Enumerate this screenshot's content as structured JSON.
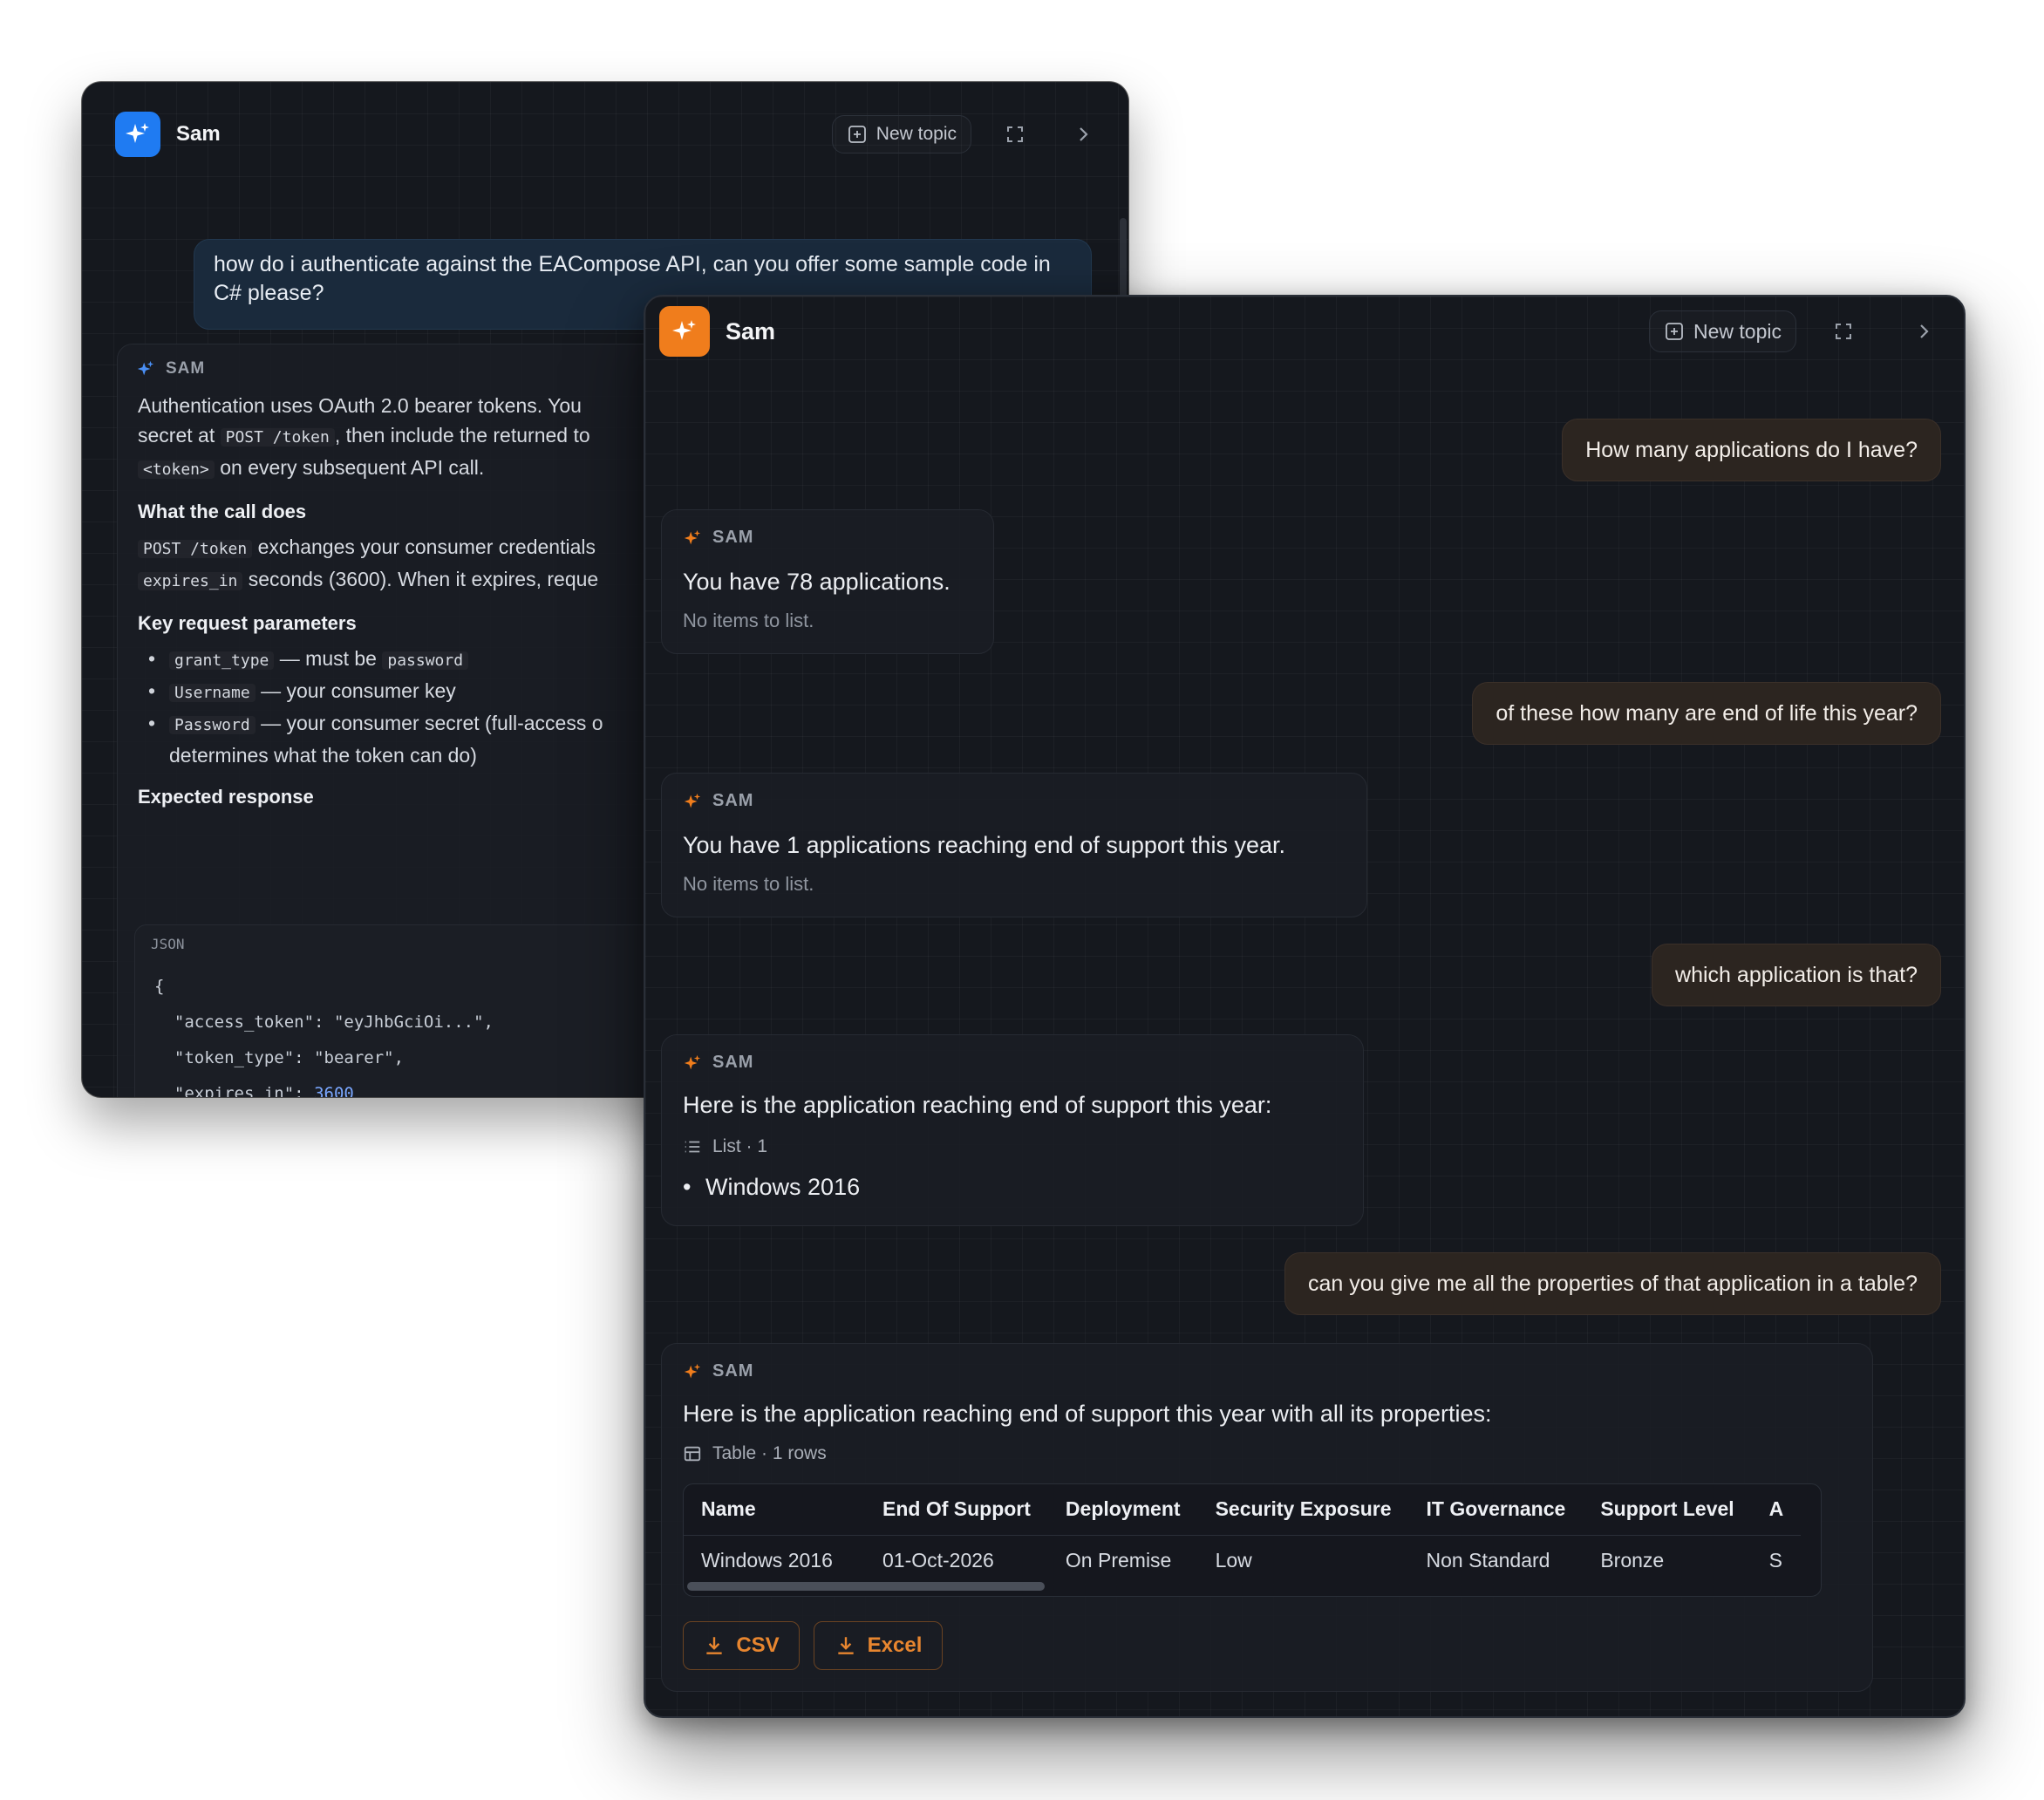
{
  "back_window": {
    "app_name": "Sam",
    "new_topic_label": "New topic",
    "user_message": "how do i authenticate against the EACompose API, can you offer some sample code in C# please?",
    "assistant_label": "SAM",
    "intro_1": "Authentication uses OAuth 2.0 bearer tokens. You",
    "intro_2a": "secret at ",
    "intro_2_code": "POST /token",
    "intro_2b": ", then include the returned to",
    "intro_3_code": "<token>",
    "intro_3b": " on every subsequent API call.",
    "what_heading": "What the call does",
    "what_1_code": "POST /token",
    "what_1b": " exchanges your consumer credentials",
    "what_2_code": "expires_in",
    "what_2b": " seconds (3600). When it expires, reque",
    "params_heading": "Key request parameters",
    "params": [
      {
        "code": "grant_type",
        "text": " — must be ",
        "code2": "password"
      },
      {
        "code": "Username",
        "text": " — your consumer key"
      },
      {
        "code": "Password",
        "text": " — your consumer secret (full-access o",
        "line2": "determines what the token can do)"
      }
    ],
    "response_heading": "Expected response",
    "json_tag": "JSON",
    "json_open": "{",
    "json_close": "}",
    "json_fields": [
      {
        "key": "\"access_token\"",
        "value": "\"eyJhbGciOi...\"",
        "trail": ","
      },
      {
        "key": "\"token_type\"",
        "value": "\"bearer\"",
        "trail": ","
      },
      {
        "key": "\"expires_in\"",
        "value": "3600",
        "trail": ""
      }
    ],
    "accent": "#1f7bf2"
  },
  "front_window": {
    "app_name": "Sam",
    "new_topic_label": "New topic",
    "accent": "#f07d1c",
    "assistant_label": "SAM",
    "messages": [
      {
        "user": "How many applications do I have?"
      },
      {
        "reply": "You have 78 applications.",
        "note": "No items to list."
      },
      {
        "user": "of these how many are end of life this year?"
      },
      {
        "reply": "You have 1 applications reaching end of support this year.",
        "note": "No items to list."
      },
      {
        "user": "which application is that?"
      },
      {
        "reply": "Here is the application reaching end of support this year:",
        "meta": "List · 1",
        "items": [
          "Windows 2016"
        ]
      },
      {
        "user": "can you give me all the properties of that application in a table?"
      },
      {
        "reply": "Here is the application reaching end of support this year with all its properties:",
        "meta": "Table · 1 rows"
      }
    ],
    "table": {
      "columns": [
        "Name",
        "End Of Support",
        "Deployment",
        "Security Exposure",
        "IT Governance",
        "Support Level",
        "A"
      ],
      "rows": [
        [
          "Windows 2016",
          "01-Oct-2026",
          "On Premise",
          "Low",
          "Non Standard",
          "Bronze",
          "S"
        ]
      ]
    },
    "csv_label": "CSV",
    "excel_label": "Excel"
  }
}
